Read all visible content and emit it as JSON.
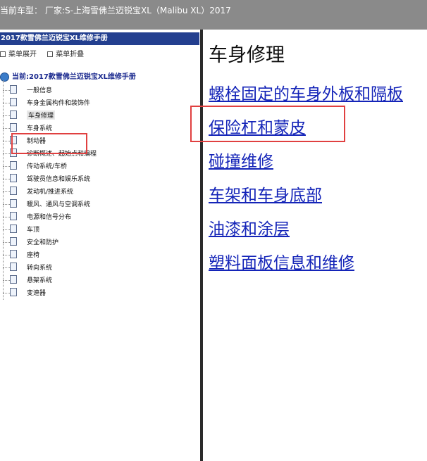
{
  "topbar": {
    "label": "当前车型：",
    "value": "厂家:S-上海雪佛兰迈锐宝XL（Malibu XL）2017"
  },
  "left_panel": {
    "manual_title": "2017款雪佛兰迈锐宝XL维修手册",
    "menu_expand": "菜单展开",
    "menu_collapse": "菜单折叠",
    "root_label": "当前:2017款雪佛兰迈锐宝XL维修手册",
    "items": [
      {
        "label": "一般信息"
      },
      {
        "label": "车身金属构件和装饰件"
      },
      {
        "label": "车身修理",
        "selected": true
      },
      {
        "label": "车身系统"
      },
      {
        "label": "制动器"
      },
      {
        "label": "诊断概述、起始点和编程"
      },
      {
        "label": "传动系统/车桥"
      },
      {
        "label": "驾驶员信息和娱乐系统"
      },
      {
        "label": "发动机/推进系统"
      },
      {
        "label": "暖风、通风与空调系统"
      },
      {
        "label": "电源和信号分布"
      },
      {
        "label": "车顶"
      },
      {
        "label": "安全和防护"
      },
      {
        "label": "座椅"
      },
      {
        "label": "转向系统"
      },
      {
        "label": "悬架系统"
      },
      {
        "label": "变速器"
      }
    ]
  },
  "right_panel": {
    "title": "车身修理",
    "links": [
      {
        "label": "螺栓固定的车身外板和隔板"
      },
      {
        "label": "保险杠和蒙皮"
      },
      {
        "label": "碰撞维修"
      },
      {
        "label": "车架和车身底部"
      },
      {
        "label": "油漆和涂层"
      },
      {
        "label": "塑料面板信息和维修"
      }
    ]
  },
  "colors": {
    "topbar_bg": "#8a8a8a",
    "manual_header_bg": "#233f8f",
    "link": "#1424b8",
    "highlight": "#e04040"
  }
}
